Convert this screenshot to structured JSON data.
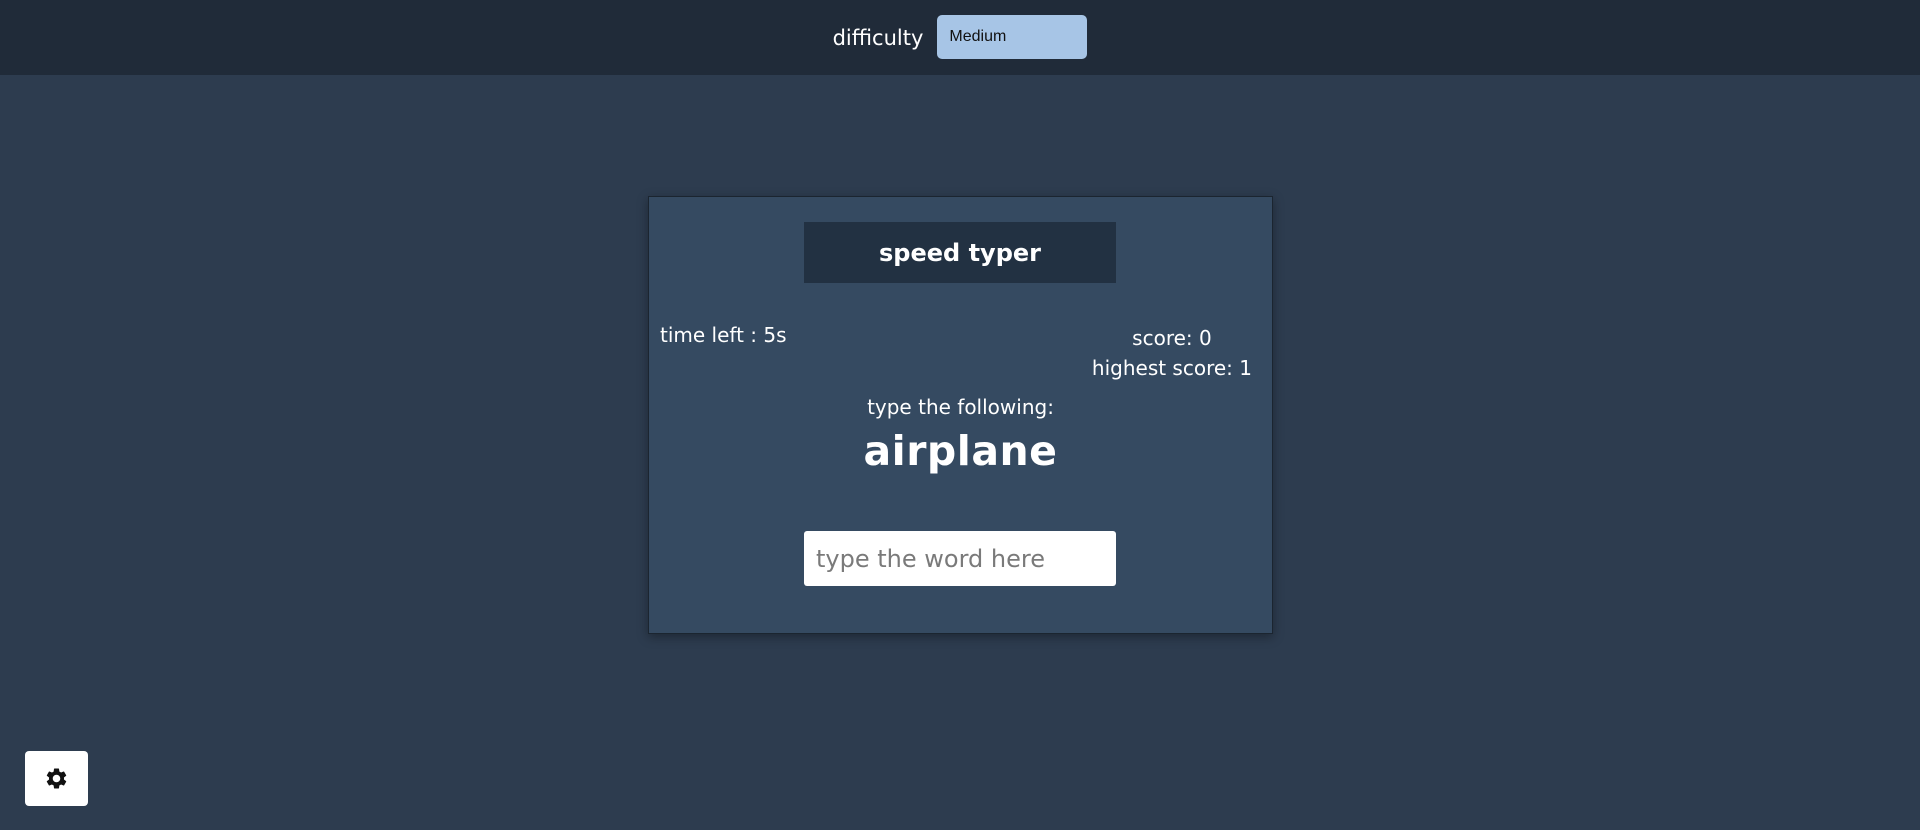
{
  "topbar": {
    "difficulty_label": "difficulty",
    "difficulty_selected": "Medium"
  },
  "card": {
    "title": "speed typer",
    "time_left": "time left : 5s",
    "score": "score: 0",
    "highest_score": "highest score: 1",
    "prompt_label": "type the following:",
    "target_word": "airplane",
    "input_placeholder": "type the word here",
    "input_value": ""
  },
  "settings": {
    "icon": "gear-icon"
  },
  "colors": {
    "page_background": "#2d3c4f",
    "topbar_background": "#202b39",
    "card_background": "#354a61",
    "title_background": "#223142",
    "select_background": "#a7c5e6"
  }
}
